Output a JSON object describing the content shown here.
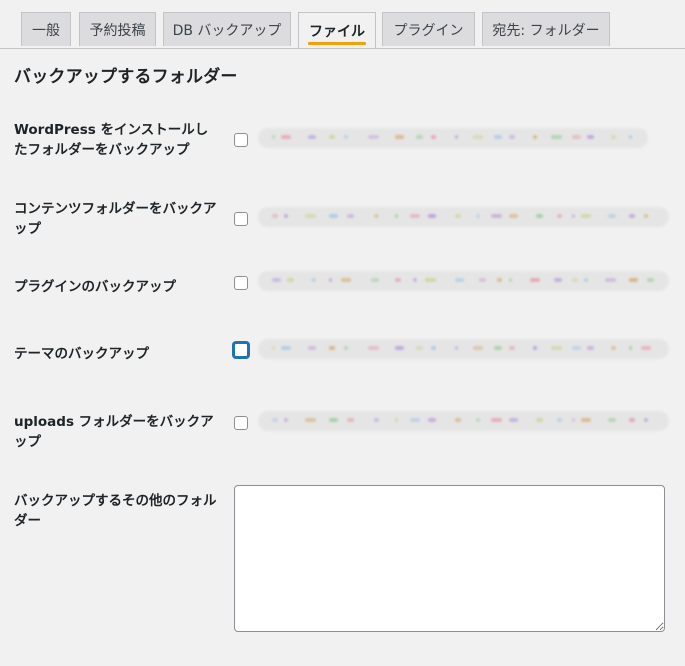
{
  "tabs": [
    {
      "label": "一般",
      "active": false
    },
    {
      "label": "予約投稿",
      "active": false
    },
    {
      "label": "DB バックアップ",
      "active": false
    },
    {
      "label": "ファイル",
      "active": true
    },
    {
      "label": "プラグイン",
      "active": false
    },
    {
      "label": "宛先: フォルダー",
      "active": false
    }
  ],
  "section": {
    "title": "バックアップするフォルダー"
  },
  "rows": [
    {
      "label": "WordPress をインストールしたフォルダーをバックアップ",
      "checked": false
    },
    {
      "label": "コンテンツフォルダーをバックアップ",
      "checked": false
    },
    {
      "label": "プラグインのバックアップ",
      "checked": false
    },
    {
      "label": "テーマのバックアップ",
      "checked": false,
      "focused": true
    },
    {
      "label": "uploads フォルダーをバックアップ",
      "checked": false
    }
  ],
  "extra": {
    "label": "バックアップするその他のフォルダー",
    "value": ""
  },
  "colors": {
    "accent": "#f0a20a",
    "focus": "#2271b1",
    "background": "#f1f1f1"
  }
}
